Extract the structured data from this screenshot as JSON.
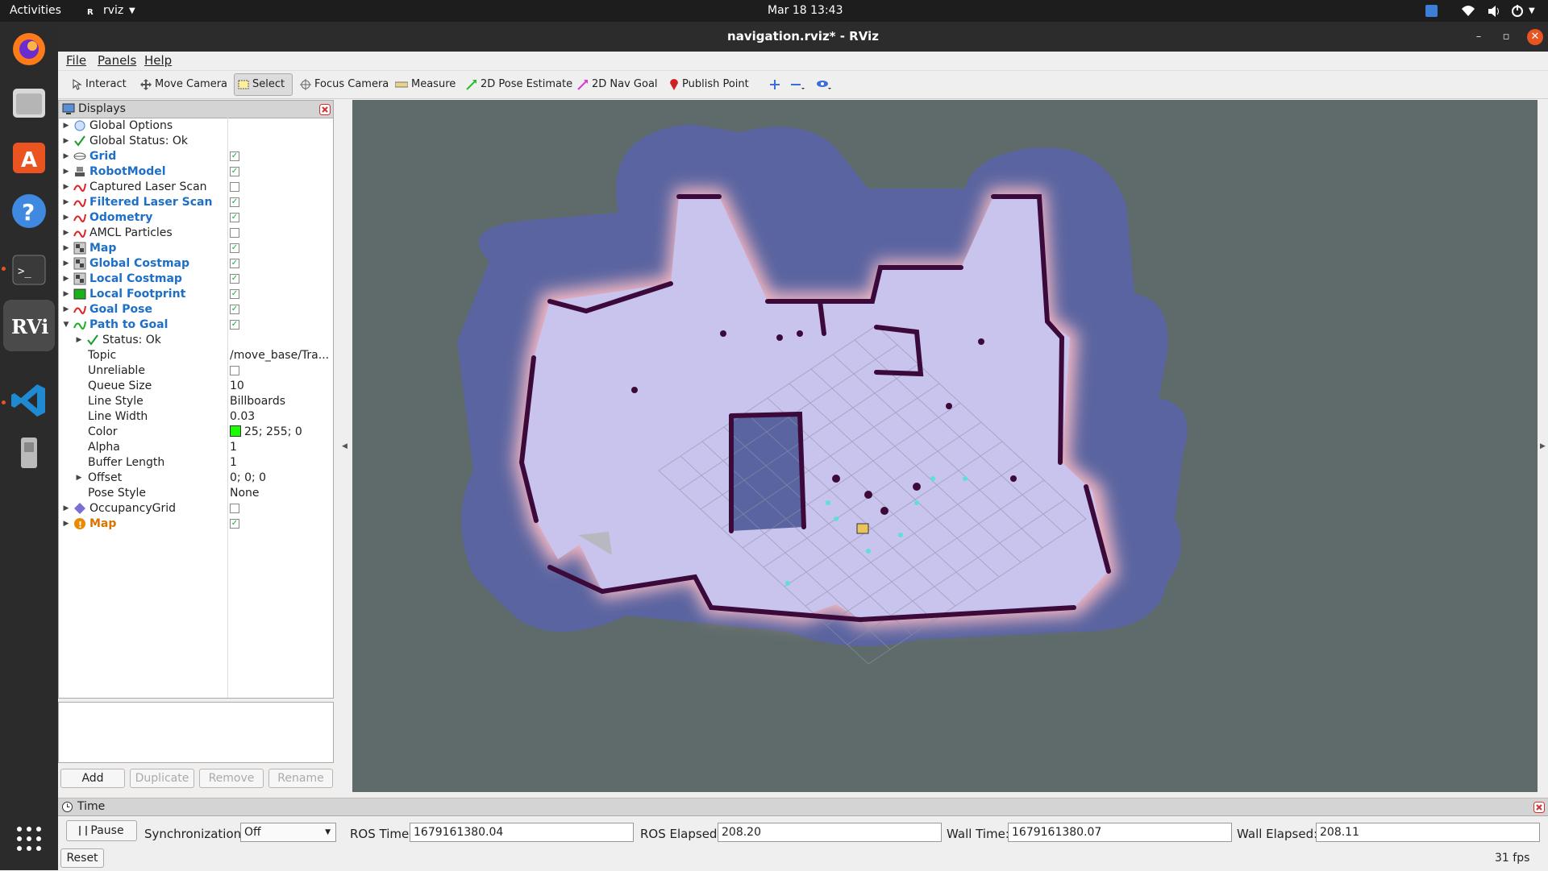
{
  "topbar": {
    "activities": "Activities",
    "app_name": "rviz",
    "clock": "Mar 18  13:43"
  },
  "window": {
    "title": "navigation.rviz* - RViz"
  },
  "menu": {
    "items": [
      "File",
      "Panels",
      "Help"
    ]
  },
  "toolbar": {
    "tools": [
      "Interact",
      "Move Camera",
      "Select",
      "Focus Camera",
      "Measure",
      "2D Pose Estimate",
      "2D Nav Goal",
      "Publish Point"
    ],
    "selected": "Select"
  },
  "displays": {
    "title": "Displays",
    "rows": [
      {
        "label": "Global Options",
        "style": "normal",
        "icon": "globe-icon"
      },
      {
        "label": "Global Status: Ok",
        "style": "normal",
        "icon": "check-icon"
      },
      {
        "label": "Grid",
        "style": "blue",
        "checked": true,
        "icon": "grid-icon"
      },
      {
        "label": "RobotModel",
        "style": "blue",
        "checked": true,
        "icon": "robot-icon"
      },
      {
        "label": "Captured Laser Scan",
        "style": "normal",
        "checked": false,
        "icon": "laser-scan-icon"
      },
      {
        "label": "Filtered Laser Scan",
        "style": "blue",
        "checked": true,
        "icon": "laser-scan-icon"
      },
      {
        "label": "Odometry",
        "style": "blue",
        "checked": true,
        "icon": "odometry-icon"
      },
      {
        "label": "AMCL Particles",
        "style": "normal",
        "checked": false,
        "icon": "particles-icon"
      },
      {
        "label": "Map",
        "style": "blue",
        "checked": true,
        "icon": "map-icon"
      },
      {
        "label": "Global Costmap",
        "style": "blue",
        "checked": true,
        "icon": "map-icon"
      },
      {
        "label": "Local Costmap",
        "style": "blue",
        "checked": true,
        "icon": "map-icon"
      },
      {
        "label": "Local Footprint",
        "style": "blue",
        "checked": true,
        "icon": "footprint-icon"
      },
      {
        "label": "Goal Pose",
        "style": "blue",
        "checked": true,
        "icon": "pose-icon"
      },
      {
        "label": "Path to Goal",
        "style": "blue",
        "checked": true,
        "icon": "path-icon",
        "expanded": true
      }
    ],
    "path_props": [
      {
        "label": "Status: Ok",
        "value": ""
      },
      {
        "label": "Topic",
        "value": "/move_base/Tra..."
      },
      {
        "label": "Unreliable",
        "value": ""
      },
      {
        "label": "Queue Size",
        "value": "10"
      },
      {
        "label": "Line Style",
        "value": "Billboards"
      },
      {
        "label": "Line Width",
        "value": "0.03"
      },
      {
        "label": "Color",
        "value": "25; 255; 0"
      },
      {
        "label": "Alpha",
        "value": "1"
      },
      {
        "label": "Buffer Length",
        "value": "1"
      },
      {
        "label": "Offset",
        "value": "0; 0; 0"
      },
      {
        "label": "Pose Style",
        "value": "None"
      }
    ],
    "tail_rows": [
      {
        "label": "OccupancyGrid",
        "style": "normal",
        "checked": false,
        "icon": "occupancy-icon"
      },
      {
        "label": "Map",
        "style": "orange",
        "checked": true,
        "icon": "warning-icon"
      }
    ],
    "color_swatch": "#19ff00"
  },
  "panel_buttons": {
    "add": "Add",
    "duplicate": "Duplicate",
    "remove": "Remove",
    "rename": "Rename"
  },
  "time": {
    "title": "Time",
    "pause": "Pause",
    "sync_label": "Synchronization:",
    "sync_value": "Off",
    "ros_time_label": "ROS Time:",
    "ros_time": "1679161380.04",
    "ros_elapsed_label": "ROS Elapsed:",
    "ros_elapsed": "208.20",
    "wall_time_label": "Wall Time:",
    "wall_time": "1679161380.07",
    "wall_elapsed_label": "Wall Elapsed:",
    "wall_elapsed": "208.11",
    "reset": "Reset",
    "fps": "31 fps"
  },
  "colors": {
    "costmap_blue": "#5a64a0",
    "free_space": "#c9c4ee",
    "wall": "#3b0a3a",
    "background": "#5f6b6b"
  }
}
